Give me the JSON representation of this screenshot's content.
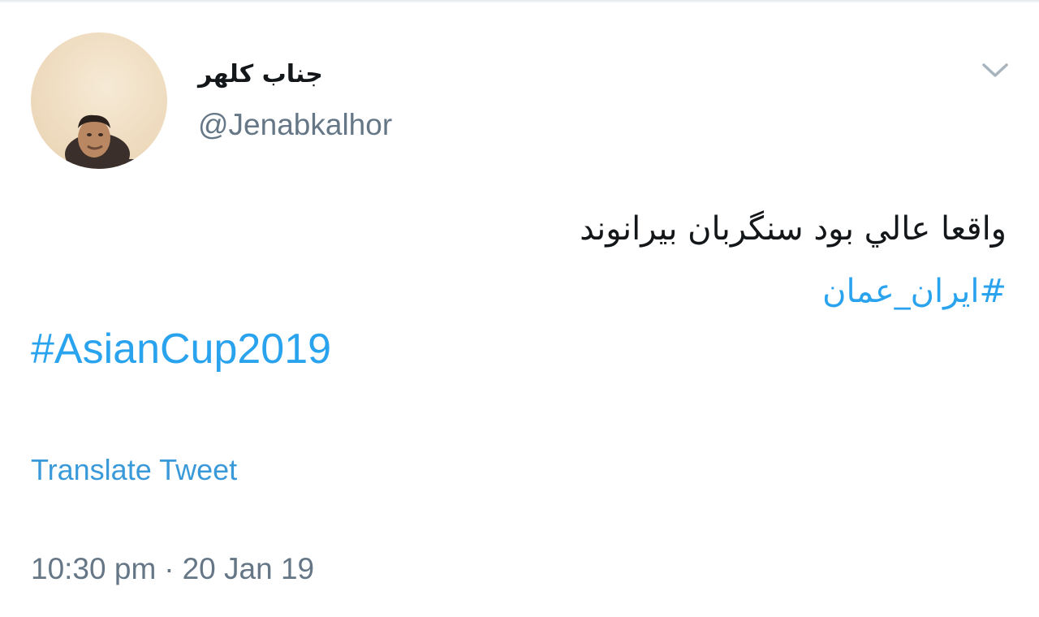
{
  "user": {
    "display_name": "جناب کلهر",
    "handle": "@Jenabkalhor"
  },
  "tweet": {
    "text": "واقعا عالي بود سنگربان بيرانوند",
    "hashtag_fa": "#ایران_عمان",
    "hashtag_en": "#AsianCup2019",
    "translate_label": "Translate Tweet",
    "time": "10:30 pm",
    "separator": "·",
    "date": "20 Jan 19"
  },
  "icons": {
    "menu": "chevron-down-icon",
    "avatar": "profile-photo"
  },
  "colors": {
    "link": "#2aa3ef",
    "muted": "#657786",
    "text": "#14171a"
  }
}
